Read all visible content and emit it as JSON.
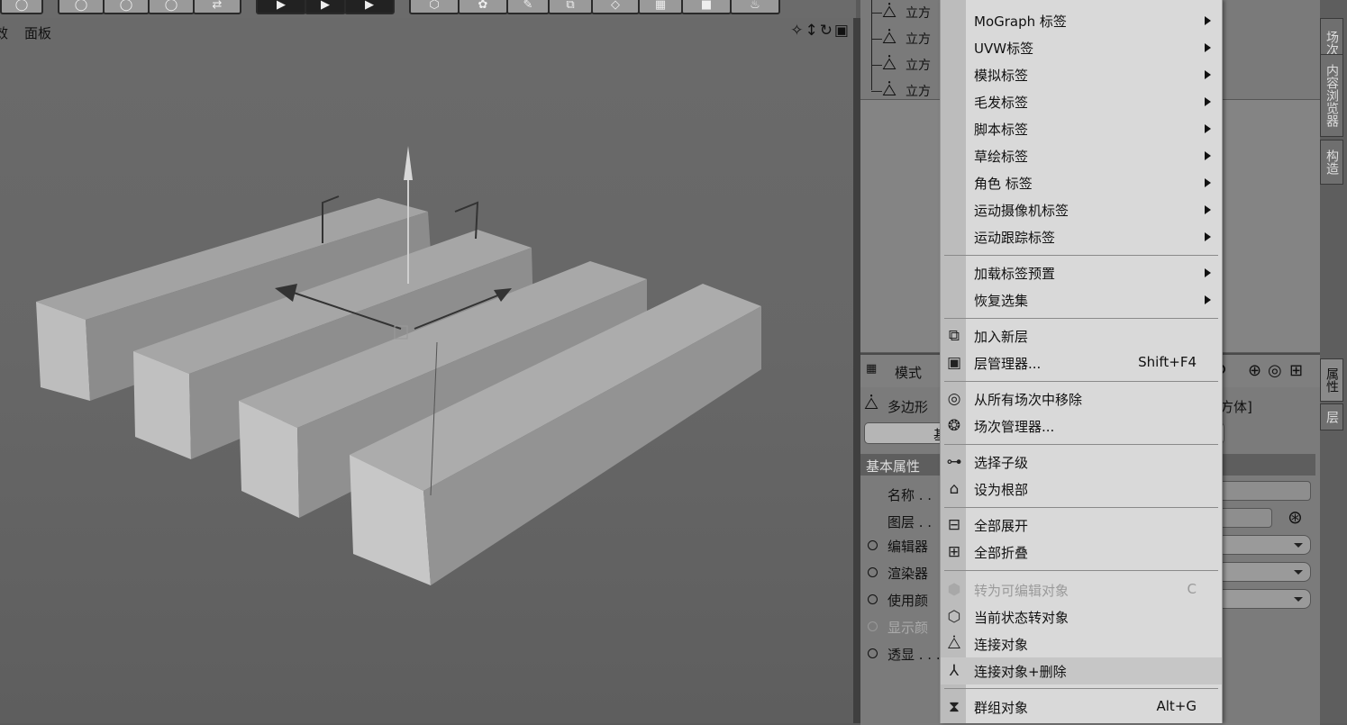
{
  "viewport": {
    "menus": [
      "效",
      "面板"
    ],
    "nav_icons": "✧↕↻▣"
  },
  "object_manager": {
    "items": [
      {
        "label": "立方"
      },
      {
        "label": "立方"
      },
      {
        "label": "立方"
      },
      {
        "label": "立方"
      }
    ]
  },
  "attribute_manager": {
    "mode_label": "模式",
    "object_type": "多边形",
    "object_name_suffix": "立方体]",
    "tab_basic": "基本",
    "section_title": "基本属性",
    "rows": [
      {
        "label": "名称 . .",
        "radio": false
      },
      {
        "label": "图层 . .",
        "radio": false
      },
      {
        "label": "编辑器",
        "radio": true,
        "dim": false
      },
      {
        "label": "渲染器",
        "radio": true,
        "dim": false
      },
      {
        "label": "使用颜",
        "radio": true,
        "dim": false
      },
      {
        "label": "显示颜",
        "radio": true,
        "dim": true
      },
      {
        "label": "透显 . . .",
        "radio": true,
        "dim": false
      }
    ]
  },
  "side_tabs": {
    "top": [
      "场次",
      "内容浏览器",
      "构造"
    ],
    "bottom": [
      "属性",
      "层"
    ]
  },
  "context_menu": {
    "items": [
      {
        "label": "MoGraph 标签",
        "submenu": true
      },
      {
        "label": "UVW标签",
        "submenu": true
      },
      {
        "label": "模拟标签",
        "submenu": true
      },
      {
        "label": "毛发标签",
        "submenu": true
      },
      {
        "label": "脚本标签",
        "submenu": true
      },
      {
        "label": "草绘标签",
        "submenu": true
      },
      {
        "label": "角色 标签",
        "submenu": true
      },
      {
        "label": "运动摄像机标签",
        "submenu": true
      },
      {
        "label": "运动跟踪标签",
        "submenu": true
      },
      {
        "label": "加载标签预置",
        "submenu": true
      },
      {
        "label": "恢复选集",
        "submenu": true
      },
      {
        "label": "加入新层",
        "icon": "new-layer-icon"
      },
      {
        "label": "层管理器...",
        "shortcut": "Shift+F4",
        "icon": "layer-manager-icon"
      },
      {
        "label": "从所有场次中移除",
        "icon": "remove-from-takes-icon"
      },
      {
        "label": "场次管理器...",
        "icon": "take-manager-icon"
      },
      {
        "label": "选择子级",
        "icon": "select-children-icon"
      },
      {
        "label": "设为根部",
        "icon": "set-as-root-icon"
      },
      {
        "label": "全部展开",
        "icon": "expand-all-icon"
      },
      {
        "label": "全部折叠",
        "icon": "collapse-all-icon"
      },
      {
        "label": "转为可编辑对象",
        "shortcut": "C",
        "disabled": true,
        "icon": "make-editable-icon"
      },
      {
        "label": "当前状态转对象",
        "icon": "current-state-to-object-icon"
      },
      {
        "label": "连接对象",
        "icon": "connect-objects-icon"
      },
      {
        "label": "连接对象+删除",
        "highlighted": true,
        "icon": "connect-and-delete-icon"
      },
      {
        "label": "群组对象",
        "shortcut": "Alt+G",
        "icon": "group-objects-icon"
      }
    ]
  },
  "colors": {
    "menu_bg": "#d9d9d9",
    "menu_highlight": "#c6c6c6",
    "viewport_bg": "#626262"
  }
}
